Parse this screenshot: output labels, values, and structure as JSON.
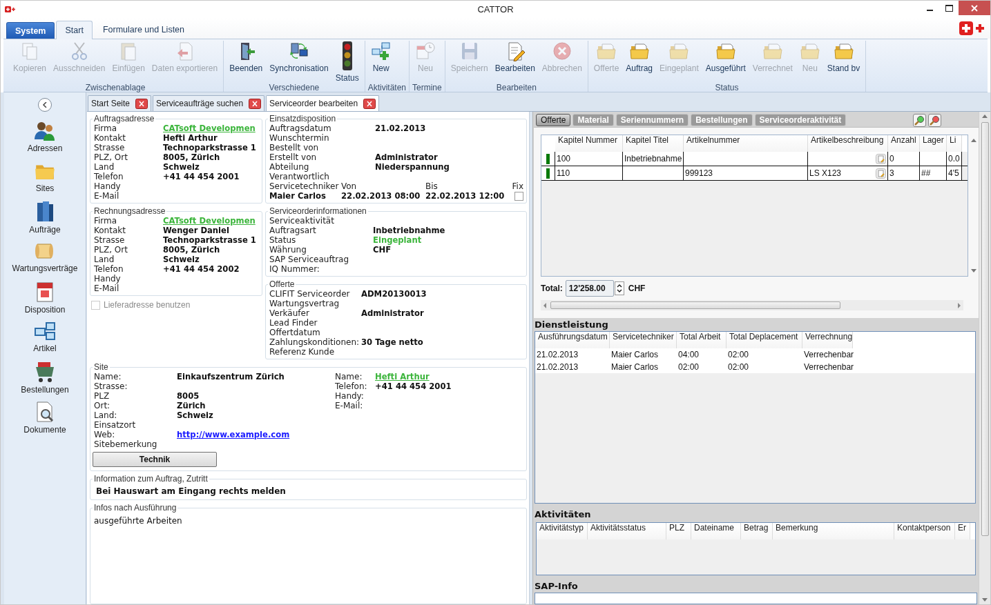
{
  "window": {
    "title": "CATTOR"
  },
  "ribbon_tabs": [
    {
      "label": "System",
      "kind": "app",
      "selected": false
    },
    {
      "label": "Start",
      "kind": "tab",
      "selected": true
    },
    {
      "label": "Formulare und Listen",
      "kind": "tab",
      "selected": false
    }
  ],
  "ribbon_groups": [
    {
      "label": "Zwischenablage",
      "buttons": [
        {
          "label": "Kopieren",
          "disabled": true
        },
        {
          "label": "Ausschneiden",
          "disabled": true
        },
        {
          "label": "Einfügen",
          "disabled": true
        },
        {
          "label": "Daten exportieren",
          "disabled": true
        }
      ]
    },
    {
      "label": "Verschiedene",
      "buttons": [
        {
          "label": "Beenden",
          "disabled": false
        },
        {
          "label": "Synchronisation",
          "disabled": false
        },
        {
          "label": "Status",
          "disabled": false
        }
      ]
    },
    {
      "label": "Aktivitäten",
      "buttons": [
        {
          "label": "New",
          "disabled": false
        }
      ]
    },
    {
      "label": "Termine",
      "buttons": [
        {
          "label": "Neu",
          "disabled": true
        }
      ]
    },
    {
      "label": "Bearbeiten",
      "buttons": [
        {
          "label": "Speichern",
          "disabled": true
        },
        {
          "label": "Bearbeiten",
          "disabled": false
        },
        {
          "label": "Abbrechen",
          "disabled": true
        }
      ]
    },
    {
      "label": "Status",
      "buttons": [
        {
          "label": "Offerte",
          "disabled": true
        },
        {
          "label": "Auftrag",
          "disabled": false
        },
        {
          "label": "Eingeplant",
          "disabled": true
        },
        {
          "label": "Ausgeführt",
          "disabled": false
        },
        {
          "label": "Verrechnet",
          "disabled": true
        },
        {
          "label": "Neu",
          "disabled": true
        },
        {
          "label": "Stand bv",
          "disabled": false
        }
      ]
    }
  ],
  "sidebar": {
    "items": [
      {
        "label": "Adressen",
        "selected": false
      },
      {
        "label": "Sites",
        "selected": false
      },
      {
        "label": "Aufträge",
        "selected": false
      },
      {
        "label": "Wartungsverträge",
        "selected": false
      },
      {
        "label": "Disposition",
        "selected": false
      },
      {
        "label": "Artikel",
        "selected": false
      },
      {
        "label": "Bestellungen",
        "selected": false
      },
      {
        "label": "Dokumente",
        "selected": false
      }
    ]
  },
  "doc_tabs": [
    {
      "label": "Start Seite",
      "selected": false
    },
    {
      "label": "Serviceaufträge suchen",
      "selected": false
    },
    {
      "label": "Serviceorder bearbeiten",
      "selected": true
    }
  ],
  "address_groups": [
    {
      "title": "Auftragsadresse",
      "fields": [
        {
          "label": "Firma",
          "value": "CATsoft Developmen",
          "kind": "link"
        },
        {
          "label": "Kontakt",
          "value": "Hefti Arthur",
          "kind": "bold"
        },
        {
          "label": "Strasse",
          "value": "Technoparkstrasse 1",
          "kind": "bold"
        },
        {
          "label": "PLZ, Ort",
          "value": "8005, Zürich",
          "kind": "bold"
        },
        {
          "label": "Land",
          "value": "Schweiz",
          "kind": "bold"
        },
        {
          "label": "Telefon",
          "value": "+41 44 454 2001",
          "kind": "bold"
        },
        {
          "label": "Handy"
        },
        {
          "label": "E-Mail"
        }
      ]
    },
    {
      "title": "Rechnungsadresse",
      "fields": [
        {
          "label": "Firma",
          "value": "CATsoft Developmen",
          "kind": "link"
        },
        {
          "label": "Kontakt",
          "value": "Wenger Daniel",
          "kind": "bold"
        },
        {
          "label": "Strasse",
          "value": "Technoparkstrasse 1",
          "kind": "bold"
        },
        {
          "label": "PLZ, Ort",
          "value": "8005, Zürich",
          "kind": "bold"
        },
        {
          "label": "Land",
          "value": "Schweiz",
          "kind": "bold"
        },
        {
          "label": "Telefon",
          "value": "+41 44 454 2002",
          "kind": "bold"
        },
        {
          "label": "Handy"
        },
        {
          "label": "E-Mail"
        }
      ]
    }
  ],
  "use_delivery_address": {
    "label": "Lieferadresse benutzen",
    "checked": false,
    "disabled": true
  },
  "dispatch": {
    "title": "Einsatzdisposition",
    "fields": [
      {
        "label": "Auftragsdatum",
        "value": "21.02.2013",
        "kind": "bold"
      },
      {
        "label": "Wunschtermin"
      },
      {
        "label": "Bestellt von"
      },
      {
        "label": "Erstellt von",
        "value": "Administrator",
        "kind": "bold"
      },
      {
        "label": "Abteilung",
        "value": "Niederspannung",
        "kind": "bold"
      },
      {
        "label": "Verantwortlich"
      }
    ],
    "schedule": {
      "technician_label": "Servicetechniker",
      "from_label": "Von",
      "to_label": "Bis",
      "fix_label": "Fix",
      "technician": "Maier Carlos",
      "from": "22.02.2013 08:00",
      "to": "22.02.2013 12:00",
      "fix": false
    }
  },
  "order_info": {
    "title": "Serviceorderinformationen",
    "fields": [
      {
        "label": "Serviceaktivität"
      },
      {
        "label": "Auftragsart",
        "value": "Inbetriebnahme",
        "kind": "bold"
      },
      {
        "label": "Status",
        "value": "Eingeplant",
        "kind": "status"
      },
      {
        "label": "Währung",
        "value": "CHF",
        "kind": "bold"
      },
      {
        "label": "SAP Serviceauftrag"
      },
      {
        "label": "IQ Nummer:"
      }
    ]
  },
  "offer": {
    "title": "Offerte",
    "fields": [
      {
        "label": "CLIFIT Serviceorder",
        "value": "ADM20130013",
        "kind": "bold"
      },
      {
        "label": "Wartungsvertrag"
      },
      {
        "label": "Verkäufer",
        "value": "Administrator",
        "kind": "bold"
      },
      {
        "label": "Lead Finder"
      },
      {
        "label": "Offertdatum"
      },
      {
        "label": "Zahlungskonditionen:",
        "value": "30 Tage netto",
        "kind": "bold"
      },
      {
        "label": "Referenz Kunde"
      }
    ]
  },
  "site": {
    "title": "Site",
    "fields": [
      {
        "label": "Name:",
        "value": "Einkaufszentrum Zürich",
        "kind": "bold"
      },
      {
        "label": "Strasse:"
      },
      {
        "label": "PLZ",
        "value": "8005",
        "kind": "bold"
      },
      {
        "label": "Ort:",
        "value": "Zürich",
        "kind": "bold"
      },
      {
        "label": "Land:",
        "value": "Schweiz",
        "kind": "bold"
      },
      {
        "label": "Einsatzort"
      },
      {
        "label": "Web:",
        "value": "http://www.example.com",
        "kind": "url"
      },
      {
        "label": "Sitebemerkung"
      }
    ],
    "contact": [
      {
        "label": "Name:",
        "value": "Hefti Arthur",
        "kind": "link"
      },
      {
        "label": "Telefon:",
        "value": "+41 44 454 2001",
        "kind": "bold"
      },
      {
        "label": "Handy:"
      },
      {
        "label": "E-Mail:"
      }
    ],
    "button": "Technik"
  },
  "access_info": {
    "title": "Information zum Auftrag, Zutritt",
    "text": "Bei Hauswart am Eingang rechts melden"
  },
  "execution_notes": {
    "title": "Infos nach Ausführung",
    "value": "ausgeführte Arbeiten"
  },
  "detail_tabs": [
    {
      "label": "Offerte",
      "selected": true
    },
    {
      "label": "Material",
      "selected": false
    },
    {
      "label": "Seriennummern",
      "selected": false
    },
    {
      "label": "Bestellungen",
      "selected": false
    },
    {
      "label": "Serviceorderaktivität",
      "selected": false
    }
  ],
  "offer_table": {
    "columns": [
      "Kapitel Nummer",
      "Kapitel Titel",
      "Artikelnummer",
      "Artikelbeschreibung",
      "Anzahl",
      "Lager",
      "Li"
    ],
    "rows": [
      [
        "100",
        "Inbetriebnahme",
        null,
        null,
        "0",
        null,
        "0.0"
      ],
      [
        "110",
        null,
        "999123",
        "LS X123",
        "3",
        "##",
        "4'5"
      ]
    ]
  },
  "total": {
    "label": "Total:",
    "value": "12'258.00",
    "currency": "CHF"
  },
  "services": {
    "title": "Dienstleistung",
    "columns": [
      "Ausführungsdatum",
      "Servicetechniker",
      "Total Arbeit",
      "Total Deplacement",
      "Verrechnung"
    ],
    "rows": [
      [
        "21.02.2013",
        "Maier Carlos",
        "04:00",
        "02:00",
        "Verrechenbar"
      ],
      [
        "21.02.2013",
        "Maier Carlos",
        "02:00",
        "02:00",
        "Verrechenbar"
      ]
    ]
  },
  "activities": {
    "title": "Aktivitäten",
    "columns": [
      "Aktivitätstyp",
      "Aktivitätsstatus",
      "PLZ",
      "Dateiname",
      "Betrag",
      "Bemerkung",
      "Kontaktperson",
      "Er"
    ]
  },
  "sap_info": {
    "title": "SAP-Info"
  }
}
